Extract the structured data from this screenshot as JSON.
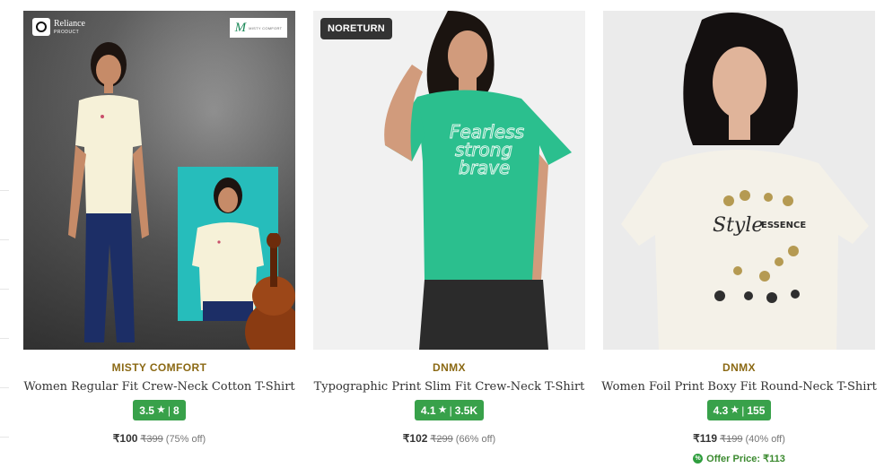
{
  "products": [
    {
      "badge": "",
      "logos": {
        "reliance_name": "Reliance",
        "reliance_sub": "PRODUCT",
        "misty_mark": "M",
        "misty_text": "MISTY COMFORT"
      },
      "brand": "MISTY COMFORT",
      "title": "Women Regular Fit Crew-Neck Cotton T-Shirt",
      "rating": "3.5",
      "reviews": "8",
      "price": "₹100",
      "mrp": "₹399",
      "discount": "(75% off)",
      "offer": ""
    },
    {
      "badge": "NORETURN",
      "brand": "DNMX",
      "title": "Typographic Print Slim Fit Crew-Neck T-Shirt",
      "rating": "4.1",
      "reviews": "3.5K",
      "price": "₹102",
      "mrp": "₹299",
      "discount": "(66% off)",
      "offer": ""
    },
    {
      "badge": "",
      "brand": "DNMX",
      "title": "Women Foil Print Boxy Fit Round-Neck T-Shirt",
      "rating": "4.3",
      "reviews": "155",
      "price": "₹119",
      "mrp": "₹199",
      "discount": "(40% off)",
      "offer": "Offer Price: ₹113"
    }
  ],
  "icons": {
    "star": "star-icon",
    "offer": "offer-tag-icon",
    "reliance": "reliance-logo",
    "misty": "misty-comfort-logo"
  },
  "colors": {
    "brand_text": "#8b6914",
    "rating_bg": "#38a14a",
    "offer_text": "#3b8a2f",
    "badge_bg": "#333333"
  }
}
